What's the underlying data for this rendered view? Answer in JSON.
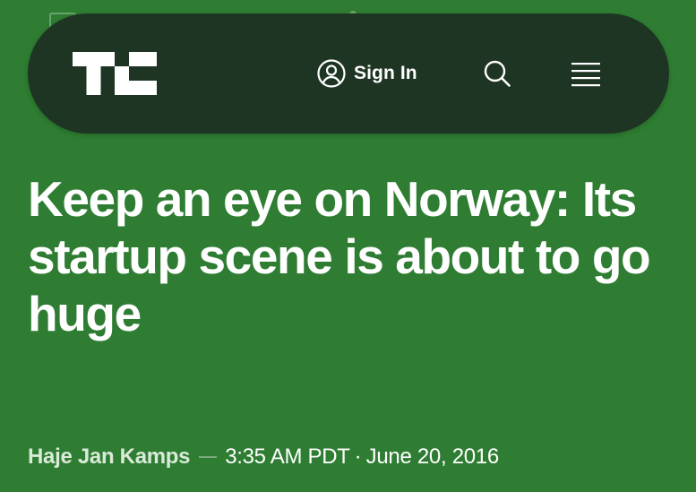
{
  "header": {
    "logo_alt": "TC",
    "sign_in_label": "Sign In"
  },
  "article": {
    "title": "Keep an eye on Norway: Its startup scene is about to go huge",
    "author": "Haje Jan Kamps",
    "time": "3:35 AM PDT",
    "separator": "·",
    "date": "June 20, 2016"
  },
  "icons": {
    "user": "user-circle-icon",
    "search": "search-icon",
    "menu": "hamburger-menu-icon"
  },
  "colors": {
    "background": "#2e7d32",
    "navbar": "#1e3524",
    "text": "#ffffff"
  }
}
